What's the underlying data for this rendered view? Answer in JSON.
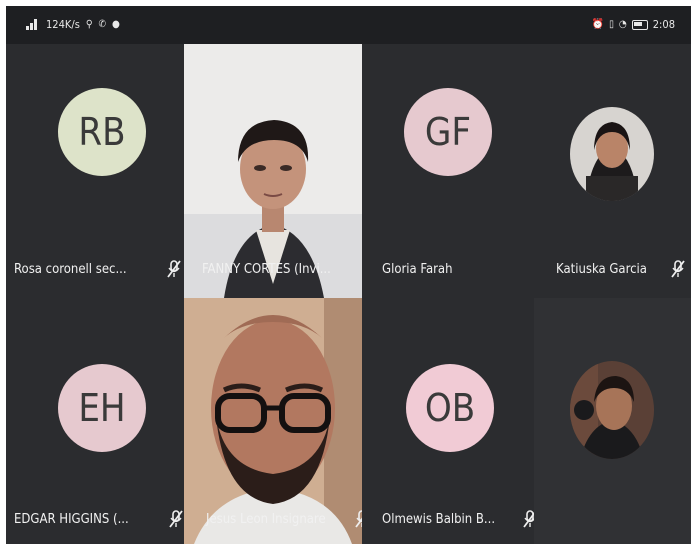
{
  "status_bar": {
    "left_text": "124K/s",
    "time": "2:08"
  },
  "participants": [
    {
      "initials": "RB",
      "name": "Rosa coronell sec...",
      "avatar_color": "#dde3c9",
      "muted": true
    },
    {
      "initials": "",
      "name": "FANNY CORTES (Invi...",
      "video": true,
      "muted": false
    },
    {
      "initials": "GF",
      "name": "Gloria Farah",
      "avatar_color": "#e6c9cf",
      "muted": false
    },
    {
      "initials": "",
      "name": "Katiuska Garcia",
      "photo_avatar": true,
      "muted": true
    },
    {
      "initials": "EH",
      "name": "EDGAR HIGGINS (...",
      "avatar_color": "#e6c9cf",
      "muted": true
    },
    {
      "initials": "",
      "name": "Jesus Leon Insignare",
      "video": true,
      "muted": true
    },
    {
      "initials": "OB",
      "name": "Olmewis Balbin B...",
      "avatar_color": "#f1cbd5",
      "muted": true
    },
    {
      "initials": "",
      "name": "",
      "photo_avatar": true,
      "muted": false
    }
  ],
  "colors": {
    "tile_bg": "#2b2c2f",
    "text": "#f1f1f1"
  },
  "icons": {
    "mic_muted": "mic-off-icon"
  }
}
